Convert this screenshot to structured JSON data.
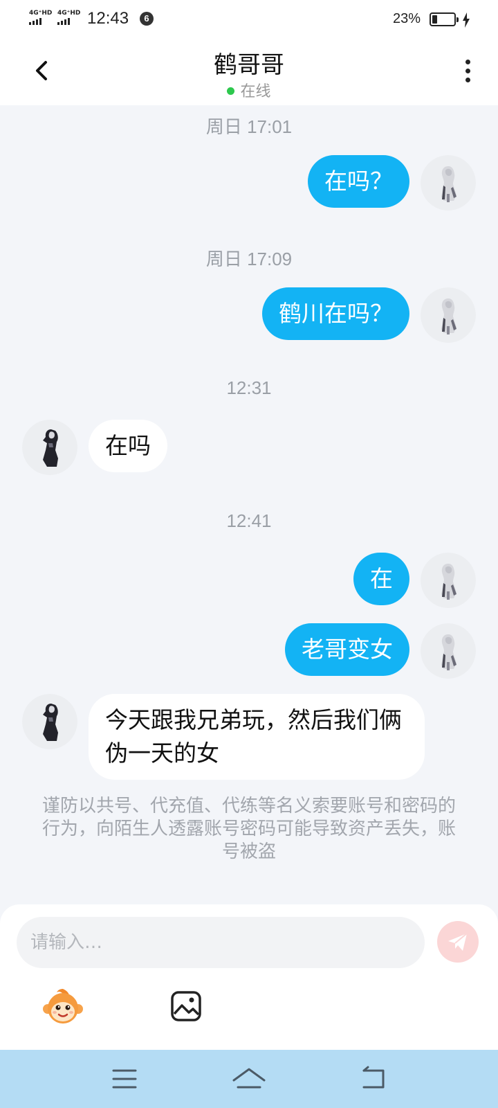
{
  "status_bar": {
    "network_1": "4G⁺HD",
    "network_2": "4G⁺HD",
    "time": "12:43",
    "notification_count": "6",
    "battery_percent": "23%"
  },
  "header": {
    "title": "鹤哥哥",
    "presence": "在线",
    "presence_color": "#2dc84d"
  },
  "messages": [
    {
      "timestamp": "周日 17:01"
    },
    {
      "direction": "out",
      "text": "在吗？"
    },
    {
      "timestamp": "周日 17:09"
    },
    {
      "direction": "out",
      "text": "鹤川在吗？"
    },
    {
      "timestamp": "12:31"
    },
    {
      "direction": "in",
      "text": "在吗"
    },
    {
      "timestamp": "12:41"
    },
    {
      "direction": "out",
      "text": "在"
    },
    {
      "direction": "out",
      "text": "老哥变女"
    },
    {
      "direction": "in",
      "text": "今天跟我兄弟玩，然后我们俩伪一天的女"
    }
  ],
  "notice": "谨防以共号、代充值、代练等名义索要账号和密码的行为，向陌生人透露账号密码可能导致资产丢失，账号被盗",
  "input": {
    "placeholder": "请输入…"
  },
  "colors": {
    "outgoing_bubble": "#13b3f4",
    "incoming_bubble": "#ffffff",
    "send_button": "#fbd6d6",
    "nav_bar": "#b4dcf4"
  },
  "icons": {
    "back": "chevron-left-icon",
    "more": "more-vertical-icon",
    "send": "paper-plane-icon",
    "emoji": "monkey-face-icon",
    "image": "image-icon",
    "nav_menu": "menu-icon",
    "nav_home": "home-icon",
    "nav_back": "return-icon"
  }
}
